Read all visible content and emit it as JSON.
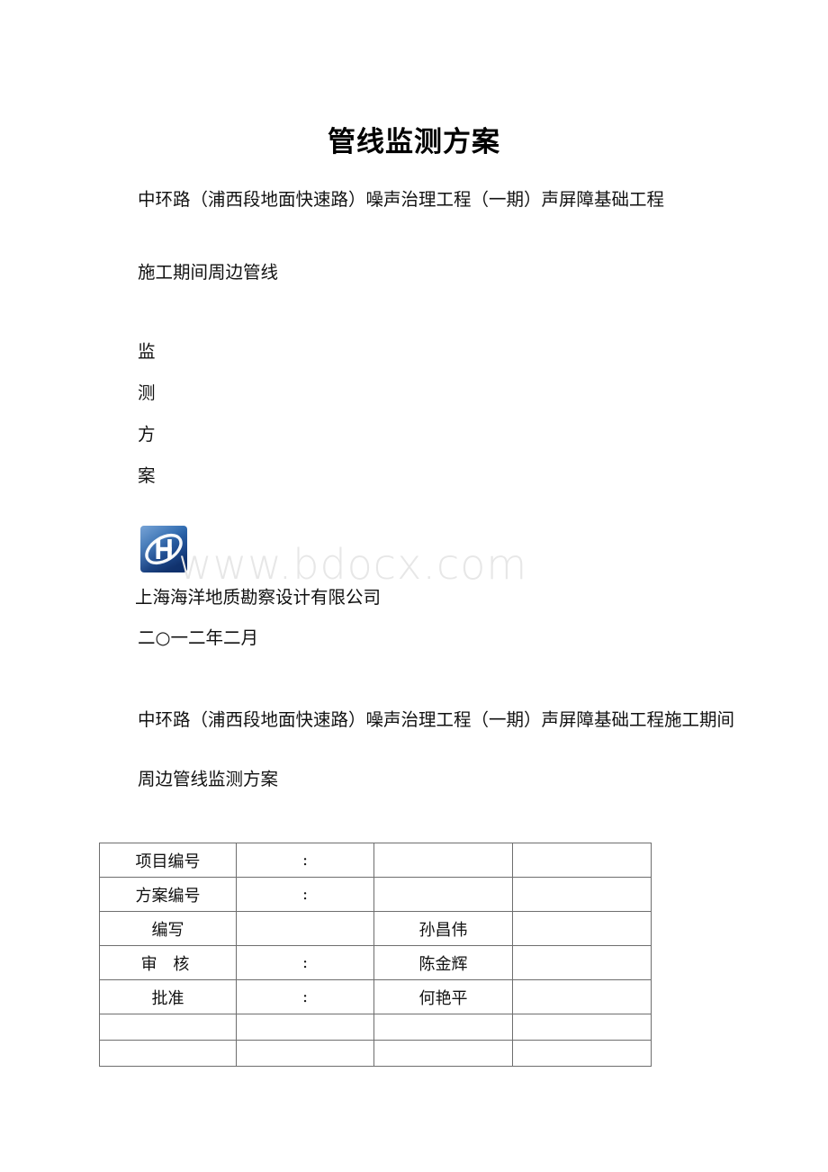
{
  "document": {
    "title": "管线监测方案",
    "cover": {
      "project_line_1": "中环路（浦西段地面快速路）噪声治理工程（一期）声屏障基础工程",
      "subtitle": "施工期间周边管线",
      "vertical_title": [
        "监",
        "测",
        "方",
        "案"
      ],
      "company": "上海海洋地质勘察设计有限公司",
      "date": "二○一二年二月",
      "logo_letter": "H"
    },
    "second_block": {
      "project_line": "中环路（浦西段地面快速路）噪声治理工程（一期）声屏障基础工程施工期间",
      "subtitle": "周边管线监测方案"
    },
    "watermark": "www.bdocx.com",
    "signature_table": {
      "rows": [
        {
          "label": "项目编号",
          "colon": ":",
          "name": "",
          "blank": ""
        },
        {
          "label": "方案编号",
          "colon": ":",
          "name": "",
          "blank": ""
        },
        {
          "label": "编写",
          "colon": "",
          "name": "孙昌伟",
          "blank": ""
        },
        {
          "label": "审 核",
          "colon": ":",
          "name": "陈金辉",
          "blank": ""
        },
        {
          "label": "批准",
          "colon": ":",
          "name": "何艳平",
          "blank": ""
        },
        {
          "label": "",
          "colon": "",
          "name": "",
          "blank": ""
        },
        {
          "label": "",
          "colon": "",
          "name": "",
          "blank": ""
        }
      ]
    },
    "colors": {
      "logo_blue_light": "#2f6fba",
      "logo_blue_dark": "#103a76",
      "table_border": "#6e6e6e",
      "watermark_gray": "#e7e7e7"
    }
  }
}
